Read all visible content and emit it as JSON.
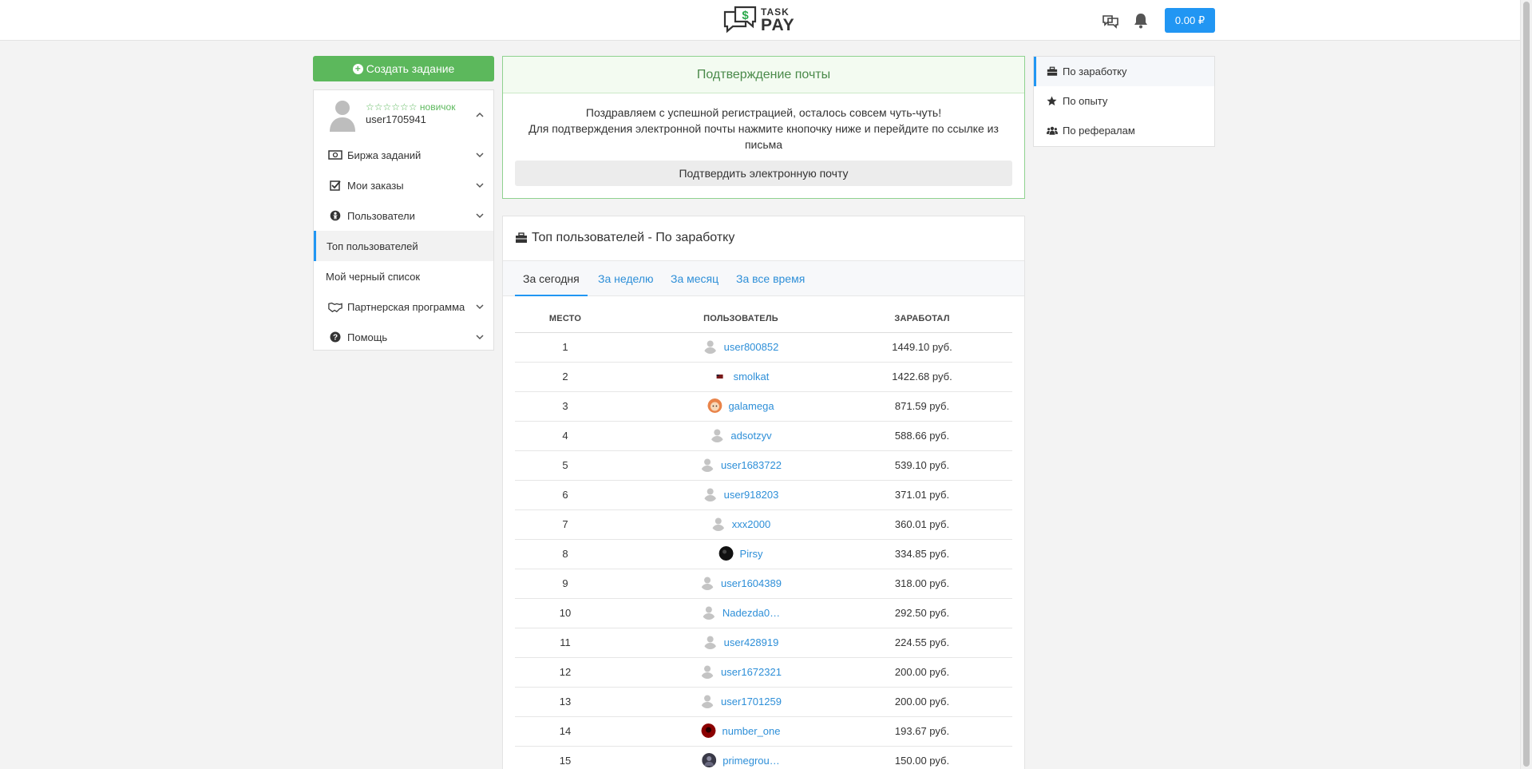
{
  "header": {
    "logo_line1": "TASK",
    "logo_line2": "PAY",
    "balance": "0.00 ₽",
    "chat_icon": "chat-bubbles-icon",
    "bell_icon": "bell-icon"
  },
  "sidebar": {
    "create_task": "Создать задание",
    "rating_stars": "☆☆☆☆☆☆",
    "rating_label": "новичок",
    "username": "user1705941",
    "items": [
      {
        "label": "Биржа заданий",
        "icon": "money-icon"
      },
      {
        "label": "Мои заказы",
        "icon": "checkbox-icon"
      },
      {
        "label": "Пользователи",
        "icon": "person-circle-icon"
      },
      {
        "label": "Топ пользователей",
        "icon": ""
      },
      {
        "label": "Мой черный список",
        "icon": ""
      },
      {
        "label": "Партнерская программа",
        "icon": "handshake-icon"
      },
      {
        "label": "Помощь",
        "icon": "question-icon"
      }
    ]
  },
  "confirm": {
    "title": "Подтверждение почты",
    "line1": "Поздравляем с успешной регистрацией, осталось совсем чуть-чуть!",
    "line2": "Для подтверждения электронной почты нажмите кнопочку ниже и перейдите по ссылке из письма",
    "button": "Подтвердить электронную почту"
  },
  "top": {
    "title": "Топ пользователей - По заработку",
    "tabs": [
      "За сегодня",
      "За неделю",
      "За месяц",
      "За все время"
    ],
    "columns": [
      "Место",
      "Пользователь",
      "Заработал"
    ],
    "rows": [
      {
        "rank": "1",
        "user": "user800852",
        "earned": "1449.10 руб."
      },
      {
        "rank": "2",
        "user": "smolkat",
        "earned": "1422.68 руб."
      },
      {
        "rank": "3",
        "user": "galamega",
        "earned": "871.59 руб."
      },
      {
        "rank": "4",
        "user": "adsotzyv",
        "earned": "588.66 руб."
      },
      {
        "rank": "5",
        "user": "user1683722",
        "earned": "539.10 руб."
      },
      {
        "rank": "6",
        "user": "user918203",
        "earned": "371.01 руб."
      },
      {
        "rank": "7",
        "user": "xxx2000",
        "earned": "360.01 руб."
      },
      {
        "rank": "8",
        "user": "Pirsy",
        "earned": "334.85 руб."
      },
      {
        "rank": "9",
        "user": "user1604389",
        "earned": "318.00 руб."
      },
      {
        "rank": "10",
        "user": "Nadezda0…",
        "earned": "292.50 руб."
      },
      {
        "rank": "11",
        "user": "user428919",
        "earned": "224.55 руб."
      },
      {
        "rank": "12",
        "user": "user1672321",
        "earned": "200.00 руб."
      },
      {
        "rank": "13",
        "user": "user1701259",
        "earned": "200.00 руб."
      },
      {
        "rank": "14",
        "user": "number_one",
        "earned": "193.67 руб."
      },
      {
        "rank": "15",
        "user": "primegrou…",
        "earned": "150.00 руб."
      }
    ]
  },
  "right_nav": {
    "items": [
      {
        "label": "По заработку",
        "icon": "briefcase-icon"
      },
      {
        "label": "По опыту",
        "icon": "star-icon"
      },
      {
        "label": "По рефералам",
        "icon": "users-icon"
      }
    ]
  },
  "colors": {
    "accent": "#2196f3",
    "success": "#5cb85c",
    "link": "#2e8fd8"
  }
}
